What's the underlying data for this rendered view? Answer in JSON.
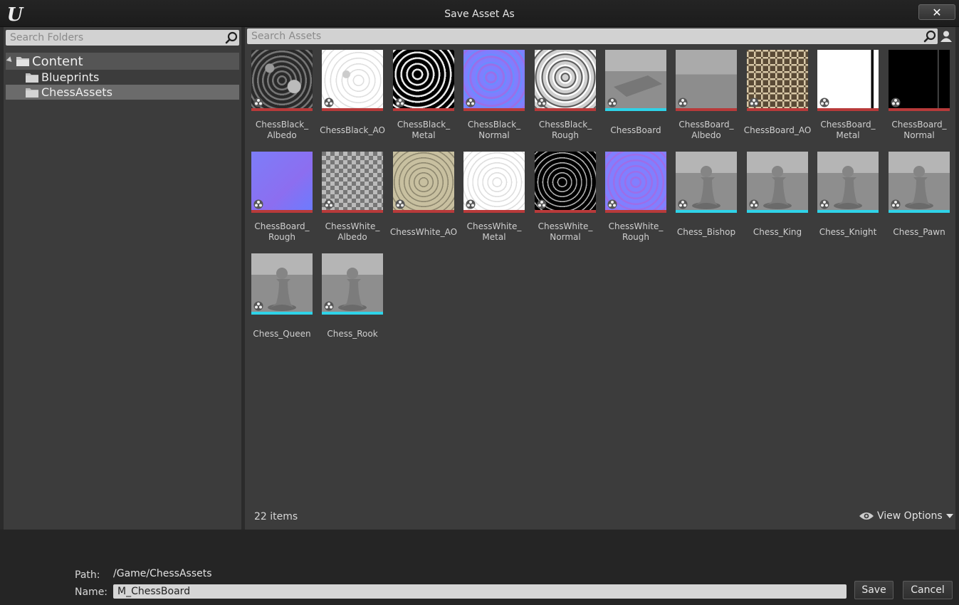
{
  "window": {
    "title": "Save Asset As",
    "close_label": "✕"
  },
  "folders": {
    "search_placeholder": "Search Folders",
    "root": "Content",
    "children": [
      "Blueprints",
      "ChessAssets"
    ],
    "selected": "ChessAssets"
  },
  "assets": {
    "search_placeholder": "Search Assets",
    "items": [
      {
        "name": "ChessBlack_\nAlbedo",
        "kind": "texture",
        "bar_color": "#b83a3a"
      },
      {
        "name": "ChessBlack_AO",
        "kind": "texture",
        "bar_color": "#b83a3a"
      },
      {
        "name": "ChessBlack_\nMetal",
        "kind": "texture",
        "bar_color": "#b83a3a"
      },
      {
        "name": "ChessBlack_\nNormal",
        "kind": "texture",
        "bar_color": "#b83a3a"
      },
      {
        "name": "ChessBlack_\nRough",
        "kind": "texture",
        "bar_color": "#b83a3a"
      },
      {
        "name": "ChessBoard",
        "kind": "mesh",
        "bar_color": "#2fd3e8"
      },
      {
        "name": "ChessBoard_\nAlbedo",
        "kind": "texture",
        "bar_color": "#b83a3a"
      },
      {
        "name": "ChessBoard_AO",
        "kind": "texture",
        "bar_color": "#b83a3a"
      },
      {
        "name": "ChessBoard_\nMetal",
        "kind": "texture",
        "bar_color": "#b83a3a"
      },
      {
        "name": "ChessBoard_\nNormal",
        "kind": "texture",
        "bar_color": "#b83a3a"
      },
      {
        "name": "ChessBoard_\nRough",
        "kind": "texture",
        "bar_color": "#b83a3a"
      },
      {
        "name": "ChessWhite_\nAlbedo",
        "kind": "texture",
        "bar_color": "#b83a3a"
      },
      {
        "name": "ChessWhite_AO",
        "kind": "texture",
        "bar_color": "#b83a3a"
      },
      {
        "name": "ChessWhite_\nMetal",
        "kind": "texture",
        "bar_color": "#b83a3a"
      },
      {
        "name": "ChessWhite_\nNormal",
        "kind": "texture",
        "bar_color": "#b83a3a"
      },
      {
        "name": "ChessWhite_\nRough",
        "kind": "texture",
        "bar_color": "#b83a3a"
      },
      {
        "name": "Chess_Bishop",
        "kind": "mesh",
        "bar_color": "#2fd3e8"
      },
      {
        "name": "Chess_King",
        "kind": "mesh",
        "bar_color": "#2fd3e8"
      },
      {
        "name": "Chess_Knight",
        "kind": "mesh",
        "bar_color": "#2fd3e8"
      },
      {
        "name": "Chess_Pawn",
        "kind": "mesh",
        "bar_color": "#2fd3e8"
      },
      {
        "name": "Chess_Queen",
        "kind": "mesh",
        "bar_color": "#2fd3e8"
      },
      {
        "name": "Chess_Rook",
        "kind": "mesh",
        "bar_color": "#2fd3e8"
      }
    ],
    "count_label": "22 items",
    "view_options_label": "View Options"
  },
  "footer": {
    "path_label": "Path:",
    "path_value": "/Game/ChessAssets",
    "name_label": "Name:",
    "name_value": "M_ChessBoard",
    "save_label": "Save",
    "cancel_label": "Cancel"
  },
  "icons": {
    "logo": "unreal-logo-icon",
    "search": "magnifier-icon",
    "user": "user-icon",
    "folder": "folder-icon",
    "eye": "eye-icon",
    "badge": "asset-type-badge-icon"
  }
}
